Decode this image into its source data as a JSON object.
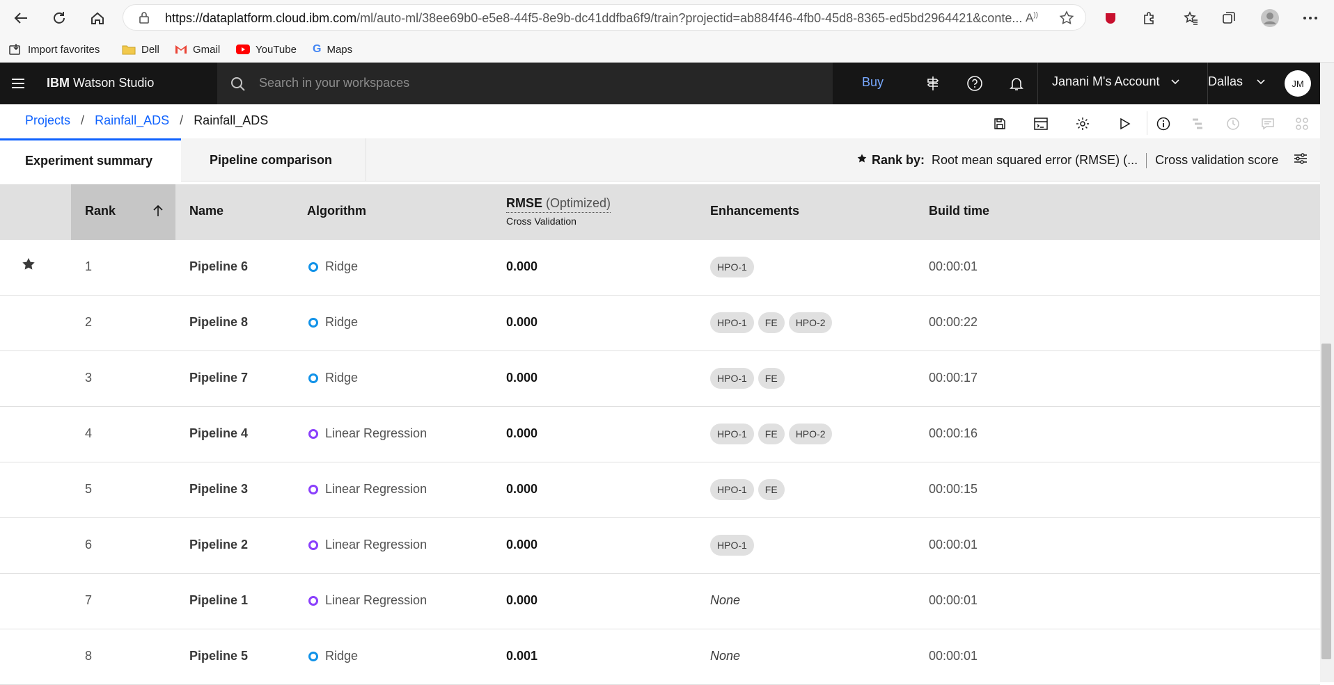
{
  "browser": {
    "url_host": "https://dataplatform.cloud.ibm.com",
    "url_path": "/ml/auto-ml/38ee69b0-e5e8-44f5-8e9b-dc41ddfba6f9/train?projectid=ab884f46-4fb0-45d8-8365-ed5bd2964421&conte...",
    "bookmarks": [
      {
        "label": "Import favorites",
        "icon": "import-icon"
      },
      {
        "label": "Dell",
        "icon": "folder-icon"
      },
      {
        "label": "Gmail",
        "icon": "gmail-icon"
      },
      {
        "label": "YouTube",
        "icon": "youtube-icon"
      },
      {
        "label": "Maps",
        "icon": "google-icon"
      }
    ]
  },
  "header": {
    "brand_bold": "IBM",
    "brand_rest": " Watson Studio",
    "search_placeholder": "Search in your workspaces",
    "buy_label": "Buy",
    "account": "Janani M's Account",
    "region": "Dallas",
    "avatar": "JM"
  },
  "breadcrumb": {
    "items": [
      "Projects",
      "Rainfall_ADS",
      "Rainfall_ADS"
    ],
    "sep": "/"
  },
  "tabs": [
    {
      "label": "Experiment summary",
      "active": true
    },
    {
      "label": "Pipeline comparison",
      "active": false
    }
  ],
  "rank_by": {
    "label": "Rank by:",
    "metric": "Root mean squared error (RMSE) (...",
    "score_type": "Cross validation score"
  },
  "table": {
    "headers": {
      "rank": "Rank",
      "name": "Name",
      "algorithm": "Algorithm",
      "metric": "RMSE",
      "metric_note": "(Optimized)",
      "metric_sub": "Cross Validation",
      "enhancements": "Enhancements",
      "build_time": "Build time"
    },
    "rows": [
      {
        "rank": "1",
        "name": "Pipeline 6",
        "algorithm": "Ridge",
        "algo_color": "#1192e8",
        "score": "0.000",
        "enhancements": [
          "HPO-1"
        ],
        "build_time": "00:00:01",
        "starred": true
      },
      {
        "rank": "2",
        "name": "Pipeline 8",
        "algorithm": "Ridge",
        "algo_color": "#1192e8",
        "score": "0.000",
        "enhancements": [
          "HPO-1",
          "FE",
          "HPO-2"
        ],
        "build_time": "00:00:22"
      },
      {
        "rank": "3",
        "name": "Pipeline 7",
        "algorithm": "Ridge",
        "algo_color": "#1192e8",
        "score": "0.000",
        "enhancements": [
          "HPO-1",
          "FE"
        ],
        "build_time": "00:00:17"
      },
      {
        "rank": "4",
        "name": "Pipeline 4",
        "algorithm": "Linear Regression",
        "algo_color": "#8a3ffc",
        "score": "0.000",
        "enhancements": [
          "HPO-1",
          "FE",
          "HPO-2"
        ],
        "build_time": "00:00:16"
      },
      {
        "rank": "5",
        "name": "Pipeline 3",
        "algorithm": "Linear Regression",
        "algo_color": "#8a3ffc",
        "score": "0.000",
        "enhancements": [
          "HPO-1",
          "FE"
        ],
        "build_time": "00:00:15"
      },
      {
        "rank": "6",
        "name": "Pipeline 2",
        "algorithm": "Linear Regression",
        "algo_color": "#8a3ffc",
        "score": "0.000",
        "enhancements": [
          "HPO-1"
        ],
        "build_time": "00:00:01"
      },
      {
        "rank": "7",
        "name": "Pipeline 1",
        "algorithm": "Linear Regression",
        "algo_color": "#8a3ffc",
        "score": "0.000",
        "enhancements": [],
        "enhancements_none": "None",
        "build_time": "00:00:01"
      },
      {
        "rank": "8",
        "name": "Pipeline 5",
        "algorithm": "Ridge",
        "algo_color": "#1192e8",
        "score": "0.001",
        "enhancements": [],
        "enhancements_none": "None",
        "build_time": "00:00:01"
      }
    ]
  }
}
